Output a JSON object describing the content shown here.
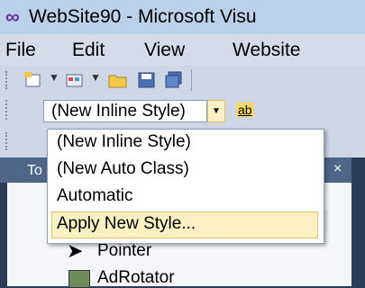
{
  "window": {
    "title": "WebSite90 - Microsoft Visu",
    "app_icon": "visual-studio-infinity-icon"
  },
  "menu": {
    "items": [
      "File",
      "Edit",
      "View",
      "Website"
    ]
  },
  "toolbar": {
    "icons": [
      "new-project-icon",
      "add-item-icon",
      "open-file-icon",
      "save-icon",
      "save-all-icon"
    ]
  },
  "style_toolbar": {
    "selected_style": "(New Inline Style)",
    "button_label": "ab"
  },
  "style_dropdown": {
    "options": [
      "(New Inline Style)",
      "(New Auto Class)",
      "Automatic",
      "Apply New Style..."
    ],
    "highlighted": "Apply New Style..."
  },
  "toolbox": {
    "title": "To",
    "close_glyph": "×",
    "items": [
      "Pointer",
      "AdRotator"
    ]
  },
  "colors": {
    "title_bar": "#b9d1ea",
    "menu_bar": "#d6dbe9",
    "highlight": "#fdf1c3",
    "toolbox_header": "#4e6687"
  }
}
